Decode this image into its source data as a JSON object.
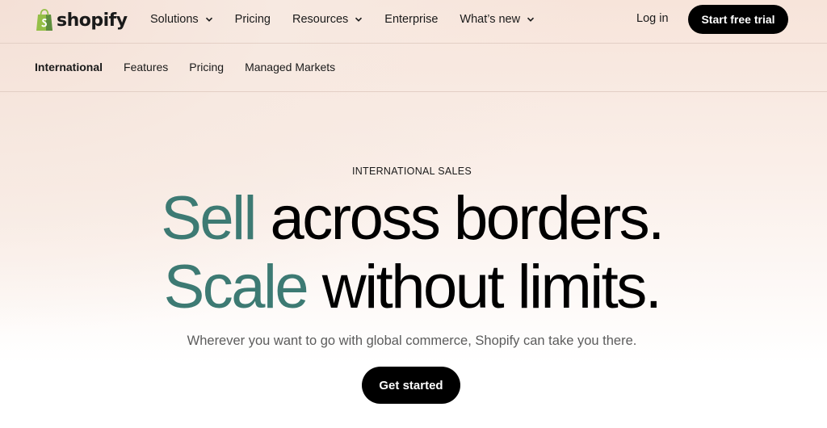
{
  "brand": {
    "name": "shopify",
    "logo_icon": "shopping-bag-icon",
    "logo_color": "#95bf47"
  },
  "topnav": {
    "items": [
      {
        "label": "Solutions",
        "has_dropdown": true
      },
      {
        "label": "Pricing",
        "has_dropdown": false
      },
      {
        "label": "Resources",
        "has_dropdown": true
      },
      {
        "label": "Enterprise",
        "has_dropdown": false
      },
      {
        "label": "What’s new",
        "has_dropdown": true
      }
    ],
    "login_label": "Log in",
    "trial_label": "Start free trial"
  },
  "subnav": {
    "items": [
      {
        "label": "International",
        "active": true
      },
      {
        "label": "Features",
        "active": false
      },
      {
        "label": "Pricing",
        "active": false
      },
      {
        "label": "Managed Markets",
        "active": false
      }
    ]
  },
  "hero": {
    "eyebrow": "INTERNATIONAL SALES",
    "line1_accent": "Sell",
    "line1_rest": " across borders.",
    "line2_accent": "Scale",
    "line2_rest": " without limits.",
    "subtitle": "Wherever you want to go with global commerce, Shopify can take you there.",
    "cta_label": "Get started"
  },
  "colors": {
    "accent": "#3d7a73",
    "button_bg": "#000000",
    "button_text": "#ffffff"
  }
}
